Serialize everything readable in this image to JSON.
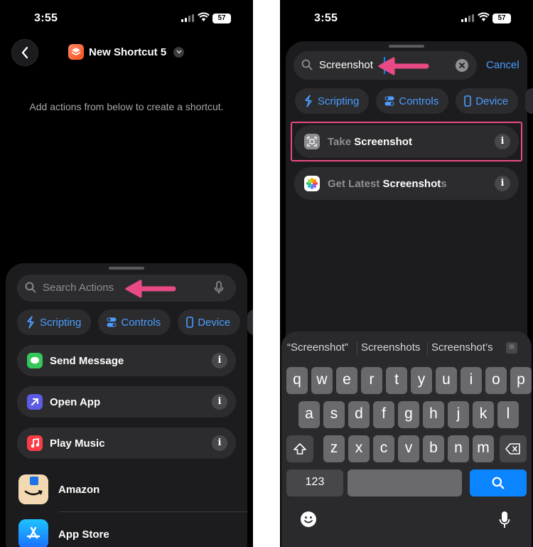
{
  "left": {
    "status": {
      "time": "3:55",
      "battery": "57"
    },
    "nav": {
      "title": "New Shortcut 5"
    },
    "empty_hint": "Add actions from below to create a shortcut.",
    "search": {
      "placeholder": "Search Actions"
    },
    "categories": [
      {
        "label": "Scripting",
        "icon": "scripting-icon"
      },
      {
        "label": "Controls",
        "icon": "toggles-icon"
      },
      {
        "label": "Device",
        "icon": "phone-icon"
      }
    ],
    "actions": [
      {
        "label": "Send Message",
        "icon": "messages-icon",
        "color": "#34c759"
      },
      {
        "label": "Open App",
        "icon": "open-app-icon",
        "color": "#5e5ce6"
      },
      {
        "label": "Play Music",
        "icon": "music-icon",
        "color": "#fc3c44"
      }
    ],
    "apps": [
      {
        "label": "Amazon",
        "icon": "amazon-icon",
        "color": "#f3d9b1"
      },
      {
        "label": "App Store",
        "icon": "app-store-icon",
        "color": "#1a8cff"
      }
    ]
  },
  "right": {
    "status": {
      "time": "3:55",
      "battery": "57"
    },
    "search": {
      "value": "Screenshot",
      "cancel": "Cancel"
    },
    "categories": [
      {
        "label": "Scripting",
        "icon": "scripting-icon"
      },
      {
        "label": "Controls",
        "icon": "toggles-icon"
      },
      {
        "label": "Device",
        "icon": "phone-icon"
      }
    ],
    "results": [
      {
        "dim": "Take ",
        "bold": "Screenshot",
        "tail": "",
        "icon": "screenshot-icon"
      },
      {
        "dim": "Get Latest ",
        "bold": "Screenshot",
        "tail": "s",
        "icon": "photos-icon"
      }
    ],
    "keyboard": {
      "suggestions": [
        "“Screenshot”",
        "Screenshots",
        "Screenshot’s"
      ],
      "row1": [
        "q",
        "w",
        "e",
        "r",
        "t",
        "y",
        "u",
        "i",
        "o",
        "p"
      ],
      "row2": [
        "a",
        "s",
        "d",
        "f",
        "g",
        "h",
        "j",
        "k",
        "l"
      ],
      "row3": [
        "z",
        "x",
        "c",
        "v",
        "b",
        "n",
        "m"
      ],
      "numbers_key": "123"
    }
  },
  "colors": {
    "accent": "#0a84ff",
    "annotation": "#e94a86"
  }
}
